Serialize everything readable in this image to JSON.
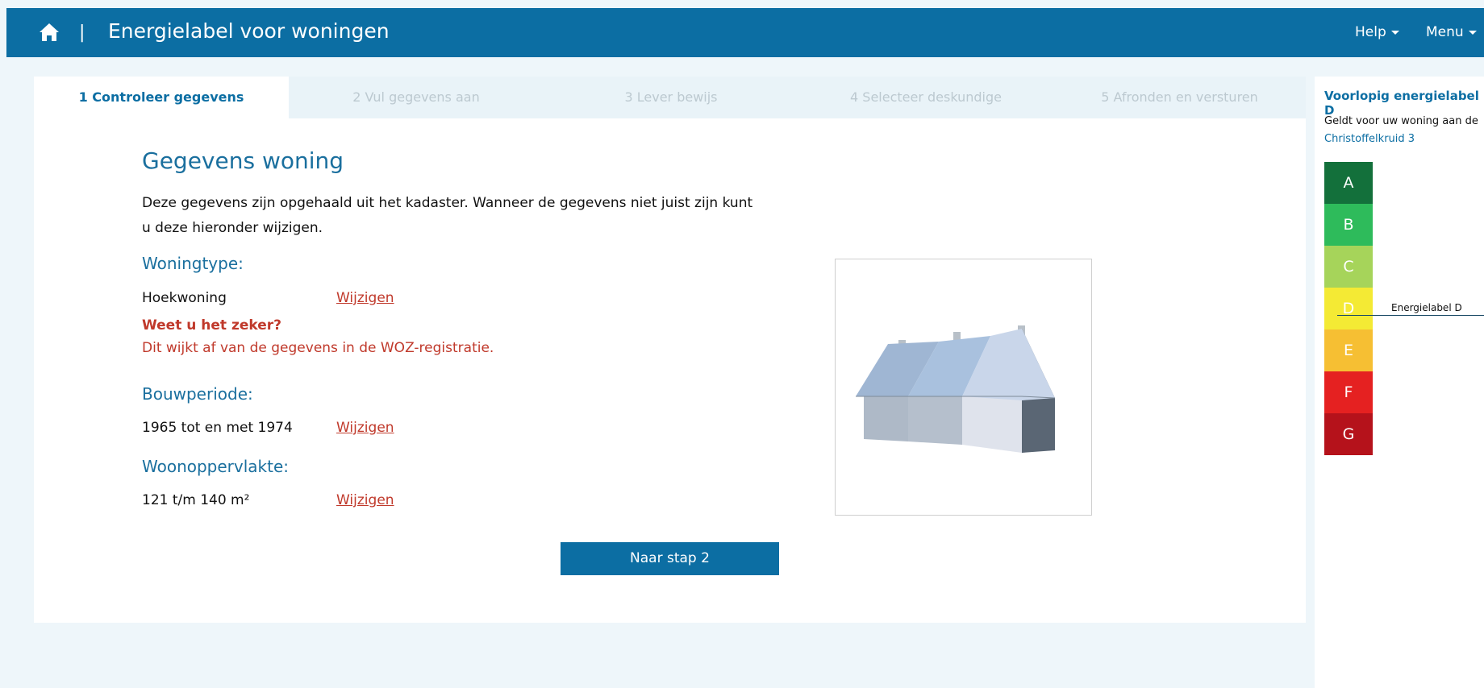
{
  "header": {
    "separator": "|",
    "title": "Energielabel voor woningen",
    "help_label": "Help",
    "menu_label": "Menu"
  },
  "steps": [
    {
      "label": "1 Controleer gegevens",
      "active": true
    },
    {
      "label": "2 Vul gegevens aan",
      "active": false
    },
    {
      "label": "3 Lever bewijs",
      "active": false
    },
    {
      "label": "4 Selecteer deskundige",
      "active": false
    },
    {
      "label": "5 Afronden en versturen",
      "active": false
    }
  ],
  "main": {
    "heading": "Gegevens woning",
    "intro": "Deze gegevens zijn opgehaald uit het kadaster. Wanneer de gegevens niet juist zijn kunt u deze hieronder wijzigen.",
    "woningtype": {
      "title": "Woningtype:",
      "value": "Hoekwoning",
      "change": "Wijzigen",
      "warning_title": "Weet u het zeker?",
      "warning_text": "Dit wijkt af van de gegevens in de WOZ-registratie."
    },
    "bouwperiode": {
      "title": "Bouwperiode:",
      "value": "1965 tot en met 1974",
      "change": "Wijzigen"
    },
    "woonoppervlakte": {
      "title": "Woonoppervlakte:",
      "value": "121 t/m 140 m²",
      "change": "Wijzigen"
    },
    "next_button": "Naar stap 2"
  },
  "sidebar": {
    "title": "Voorlopig energielabel D",
    "subtitle": "Geldt voor uw woning aan de",
    "address": "Christoffelkruid 3",
    "indicator": "Energielabel D",
    "labels": [
      {
        "letter": "A",
        "color": "#13703b"
      },
      {
        "letter": "B",
        "color": "#2ebb5b"
      },
      {
        "letter": "C",
        "color": "#a6d45a"
      },
      {
        "letter": "D",
        "color": "#f4ea34"
      },
      {
        "letter": "E",
        "color": "#f6bf33"
      },
      {
        "letter": "F",
        "color": "#e52121"
      },
      {
        "letter": "G",
        "color": "#b5121b"
      }
    ]
  }
}
